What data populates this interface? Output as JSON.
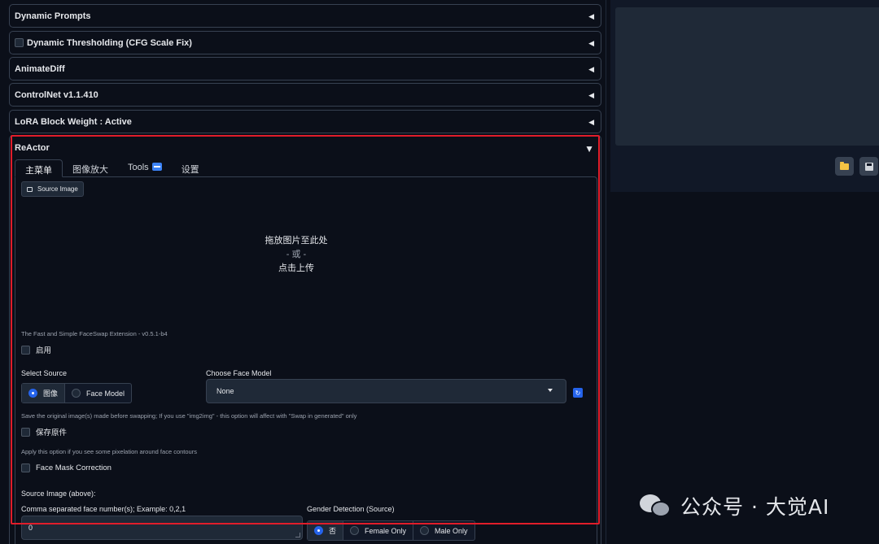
{
  "accordions": [
    {
      "title": "Dynamic Prompts",
      "has_checkbox": false
    },
    {
      "title": "Dynamic Thresholding (CFG Scale Fix)",
      "has_checkbox": true
    },
    {
      "title": "AnimateDiff",
      "has_checkbox": false
    },
    {
      "title": "ControlNet v1.1.410",
      "has_checkbox": false
    },
    {
      "title": "LoRA Block Weight : Active",
      "has_checkbox": false
    }
  ],
  "reactor": {
    "title": "ReActor",
    "tabs": [
      "主菜单",
      "图像放大",
      "Tools",
      "设置"
    ],
    "active_tab": "主菜单",
    "source_image_label": "Source Image",
    "drop_line1": "拖放图片至此处",
    "drop_or": "- 或 -",
    "drop_line2": "点击上传",
    "version_text": "The Fast and Simple FaceSwap Extension - v0.5.1-b4",
    "enable_label": "启用",
    "select_source_label": "Select Source",
    "source_options": [
      "图像",
      "Face Model"
    ],
    "source_selected": "图像",
    "choose_face_model_label": "Choose Face Model",
    "face_model_value": "None",
    "save_original_info": "Save the original image(s) made before swapping; If you use \"img2img\" - this option will affect with \"Swap in generated\" only",
    "save_original_label": "保存原件",
    "face_mask_info": "Apply this option if you see some pixelation around face contours",
    "face_mask_label": "Face Mask Correction",
    "source_image_above_label": "Source Image (above):",
    "face_numbers_label": "Comma separated face number(s); Example: 0,2,1",
    "face_numbers_value": "0",
    "gender_detection_label": "Gender Detection (Source)",
    "gender_options": [
      "否",
      "Female Only",
      "Male Only"
    ],
    "gender_selected": "否"
  },
  "watermark": "公众号 · 大觉AI",
  "icons": {
    "folder": "folder-icon",
    "save": "save-icon",
    "refresh": "refresh-icon"
  },
  "colors": {
    "highlight_frame": "#e11d2a",
    "accent": "#2563eb",
    "background": "#0b0f19"
  }
}
